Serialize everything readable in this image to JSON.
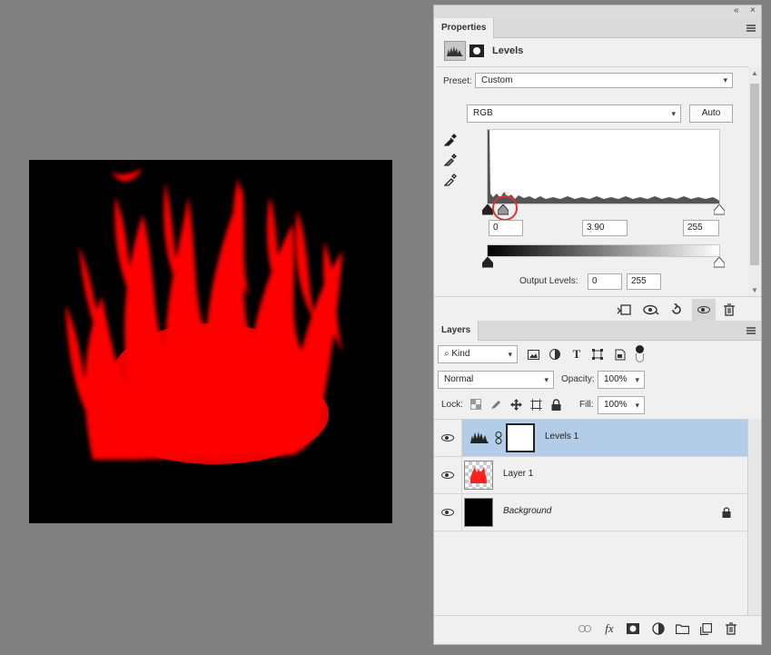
{
  "panels": {
    "collapse_glyph": "«",
    "close_glyph": "×"
  },
  "properties": {
    "tab_label": "Properties",
    "header_title": "Levels",
    "preset_label": "Preset:",
    "preset_value": "Custom",
    "channel_value": "RGB",
    "auto_label": "Auto",
    "input_black": "0",
    "input_gamma": "3.90",
    "input_white": "255",
    "output_label": "Output Levels:",
    "output_black": "0",
    "output_white": "255"
  },
  "layers": {
    "tab_label": "Layers",
    "filter_kind": "Kind",
    "blend_mode": "Normal",
    "opacity_label": "Opacity:",
    "opacity_value": "100%",
    "lock_label": "Lock:",
    "fill_label": "Fill:",
    "fill_value": "100%",
    "rows": [
      {
        "name": "Levels 1",
        "selected": true
      },
      {
        "name": "Layer 1",
        "selected": false
      },
      {
        "name": "Background",
        "selected": false
      }
    ]
  },
  "footer_fx_label": "fx",
  "colors": {
    "canvas_bg": "#808080",
    "flame": "#ff0000",
    "selection": "#b3cde8",
    "highlight_ring": "#e03030"
  }
}
